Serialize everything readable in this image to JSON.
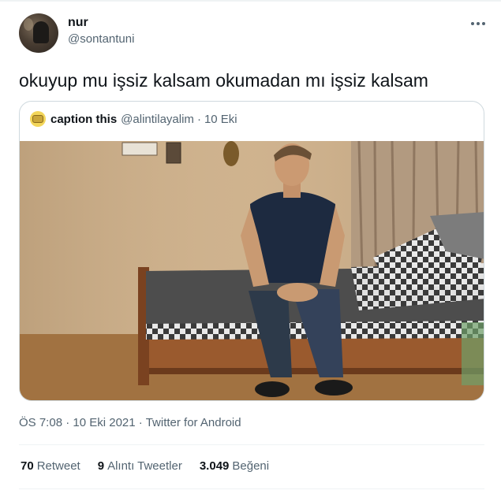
{
  "tweet": {
    "display_name": "nur",
    "handle": "@sontantuni",
    "text": "okuyup mu işsiz kalsam okumadan mı işsiz kalsam",
    "more_icon": "more-horizontal-icon"
  },
  "quote": {
    "name": "caption this",
    "handle": "@alintilayalim",
    "separator": "·",
    "date": "10 Eki",
    "avatar_icon": "emoji-face-icon"
  },
  "meta": {
    "time": "ÖS 7:08",
    "date": "10 Eki 2021",
    "source": "Twitter for Android",
    "separator": "·"
  },
  "stats": {
    "retweets_count": "70",
    "retweets_label": "Retweet",
    "quotes_count": "9",
    "quotes_label": "Alıntı Tweetler",
    "likes_count": "3.049",
    "likes_label": "Beğeni"
  },
  "colors": {
    "primary_text": "#0f1419",
    "secondary_text": "#536471",
    "border": "#cfd9de",
    "divider": "#eff3f4"
  }
}
